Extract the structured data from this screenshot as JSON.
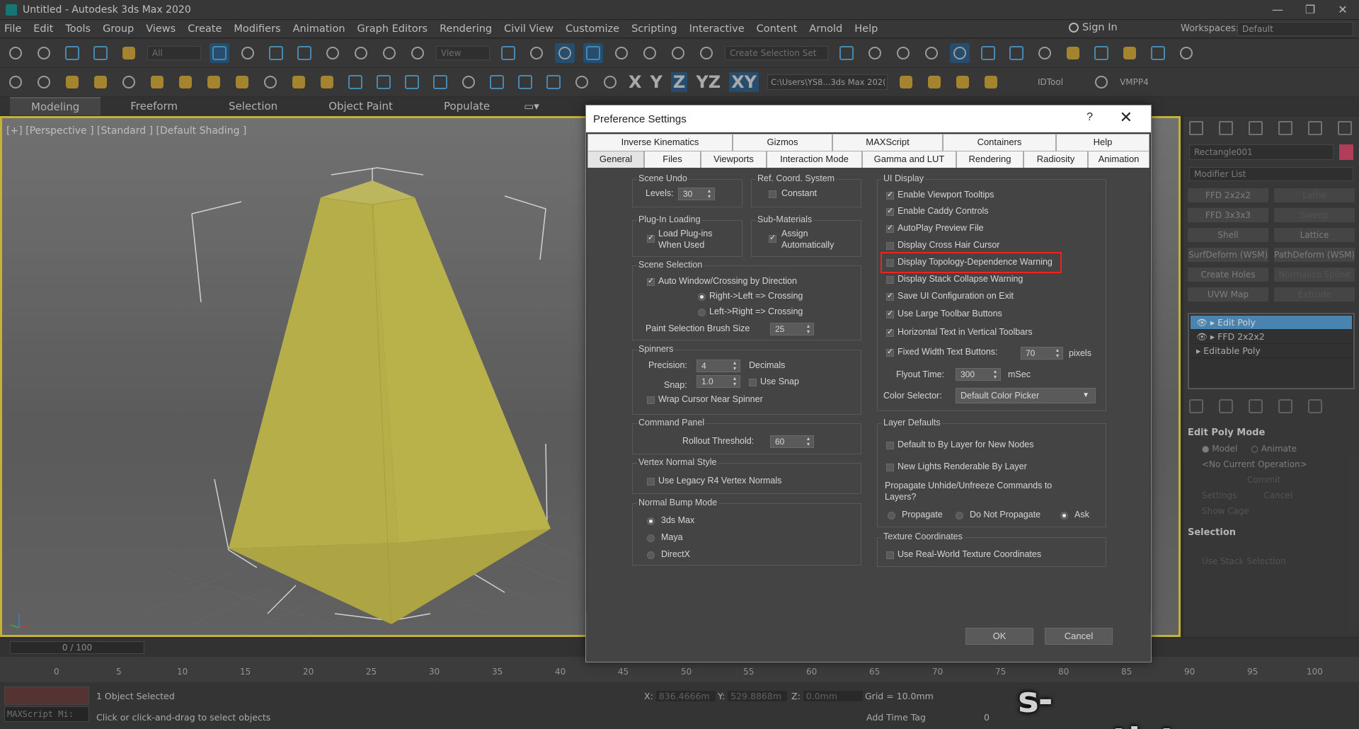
{
  "window": {
    "title": "Untitled - Autodesk 3ds Max 2020",
    "minimize": "—",
    "maximize": "❐",
    "close": "✕"
  },
  "menu": {
    "items": [
      "File",
      "Edit",
      "Tools",
      "Group",
      "Views",
      "Create",
      "Modifiers",
      "Animation",
      "Graph Editors",
      "Rendering",
      "Civil View",
      "Customize",
      "Scripting",
      "Interactive",
      "Content",
      "Arnold",
      "Help"
    ],
    "sign_in": "Sign In",
    "workspaces_label": "Workspaces:",
    "workspace_value": "Default"
  },
  "toolbar": {
    "selection_filter": "All",
    "view_drop": "View",
    "named_selection": "Create Selection Set",
    "axes": [
      "X",
      "Y",
      "Z",
      "YZ",
      "XY"
    ],
    "project_path": "C:\\Users\\YS8...3ds Max 202(",
    "idtool": "IDTool",
    "vmpp4": "VMPP4"
  },
  "ribbon": {
    "tabs": [
      "Modeling",
      "Freeform",
      "Selection",
      "Object Paint",
      "Populate"
    ]
  },
  "viewport": {
    "label": "[+] [Perspective ] [Standard ] [Default Shading ]",
    "object_color": "#dfd65a",
    "border_color": "#f1d940"
  },
  "command_panel": {
    "object_name": "Rectangle001",
    "modifier_list": "Modifier List",
    "modifiers": [
      "FFD 2x2x2",
      "Lathe",
      "FFD 3x3x3",
      "Sweep",
      "Shell",
      "Lattice",
      "SurfDeform (WSM)",
      "PathDeform (WSM)",
      "Create Holes",
      "Normalize Spline",
      "UVW Map",
      "Extrude"
    ],
    "stack": [
      "Edit Poly",
      "FFD 2x2x2",
      "Editable Poly"
    ],
    "edit_poly_mode": "Edit Poly Mode",
    "model": "Model",
    "animate": "Animate",
    "no_op": "<No Current Operation>",
    "commit": "Commit",
    "settings": "Settings",
    "cancel": "Cancel",
    "show_cage": "Show Cage",
    "selection": "Selection",
    "use_stack": "Use Stack Selection"
  },
  "timeline": {
    "slider": "0 / 100",
    "ticks": [
      "0",
      "5",
      "10",
      "15",
      "20",
      "25",
      "30",
      "35",
      "40",
      "45",
      "50",
      "55",
      "60",
      "65",
      "70",
      "75",
      "80",
      "85",
      "90",
      "95",
      "100"
    ]
  },
  "status": {
    "maxscript": "MAXScript Mi:",
    "selected": "1 Object Selected",
    "hint": "Click or click-and-drag to select objects",
    "x_label": "X:",
    "x_value": "836.4666m",
    "y_label": "Y:",
    "y_value": "529.8868m",
    "z_label": "Z:",
    "z_value": "0.0mm",
    "grid": "Grid = 10.0mm",
    "add_time_tag": "Add Time Tag",
    "frame": "0"
  },
  "watermark": "s-max.tistory.com",
  "dialog": {
    "title": "Preference Settings",
    "help": "?",
    "close": "✕",
    "tabs_row1": [
      "Inverse Kinematics",
      "Gizmos",
      "MAXScript",
      "Containers",
      "Help"
    ],
    "tabs_row2": [
      "General",
      "Files",
      "Viewports",
      "Interaction Mode",
      "Gamma and LUT",
      "Rendering",
      "Radiosity",
      "Animation"
    ],
    "scene_undo": {
      "title": "Scene Undo",
      "levels_label": "Levels:",
      "levels": "30"
    },
    "ref_coord": {
      "title": "Ref. Coord. System",
      "constant": "Constant"
    },
    "plugin_loading": {
      "title": "Plug-In Loading",
      "load_line1": "Load Plug-ins",
      "load_line2": "When Used"
    },
    "sub_materials": {
      "title": "Sub-Materials",
      "assign_line1": "Assign",
      "assign_line2": "Automatically"
    },
    "scene_selection": {
      "title": "Scene Selection",
      "auto_window": "Auto Window/Crossing by Direction",
      "right_left": "Right->Left => Crossing",
      "left_right": "Left->Right => Crossing",
      "brush_label": "Paint Selection Brush Size",
      "brush_size": "25"
    },
    "spinners": {
      "title": "Spinners",
      "precision_label": "Precision:",
      "precision": "4",
      "decimals": "Decimals",
      "snap_label": "Snap:",
      "snap": "1.0",
      "use_snap": "Use Snap",
      "wrap": "Wrap Cursor Near Spinner"
    },
    "command_panel": {
      "title": "Command Panel",
      "rollout_label": "Rollout Threshold:",
      "rollout": "60"
    },
    "vertex_normal": {
      "title": "Vertex Normal Style",
      "legacy": "Use Legacy R4 Vertex Normals"
    },
    "normal_bump": {
      "title": "Normal Bump Mode",
      "options": [
        "3ds Max",
        "Maya",
        "DirectX"
      ]
    },
    "ui_display": {
      "title": "UI Display",
      "items": [
        "Enable Viewport Tooltips",
        "Enable Caddy Controls",
        "AutoPlay Preview File",
        "Display Cross Hair Cursor",
        "Display Topology-Dependence Warning",
        "Display Stack Collapse Warning",
        "Save UI Configuration on Exit",
        "Use Large Toolbar Buttons",
        "Horizontal Text in Vertical Toolbars",
        "Fixed Width Text Buttons:"
      ],
      "fixed_width": "70",
      "pixels": "pixels",
      "flyout_label": "Flyout Time:",
      "flyout": "300",
      "msec": "mSec",
      "color_selector_label": "Color Selector:",
      "color_selector": "Default Color Picker"
    },
    "layer_defaults": {
      "title": "Layer Defaults",
      "by_layer": "Default to By Layer for New Nodes",
      "lights": "New Lights Renderable By Layer",
      "propagate_q1": "Propagate Unhide/Unfreeze Commands to",
      "propagate_q2": "Layers?",
      "options": [
        "Propagate",
        "Do Not Propagate",
        "Ask"
      ]
    },
    "texture_coords": {
      "title": "Texture Coordinates",
      "real_world": "Use Real-World Texture Coordinates"
    },
    "ok": "OK",
    "cancel": "Cancel"
  }
}
